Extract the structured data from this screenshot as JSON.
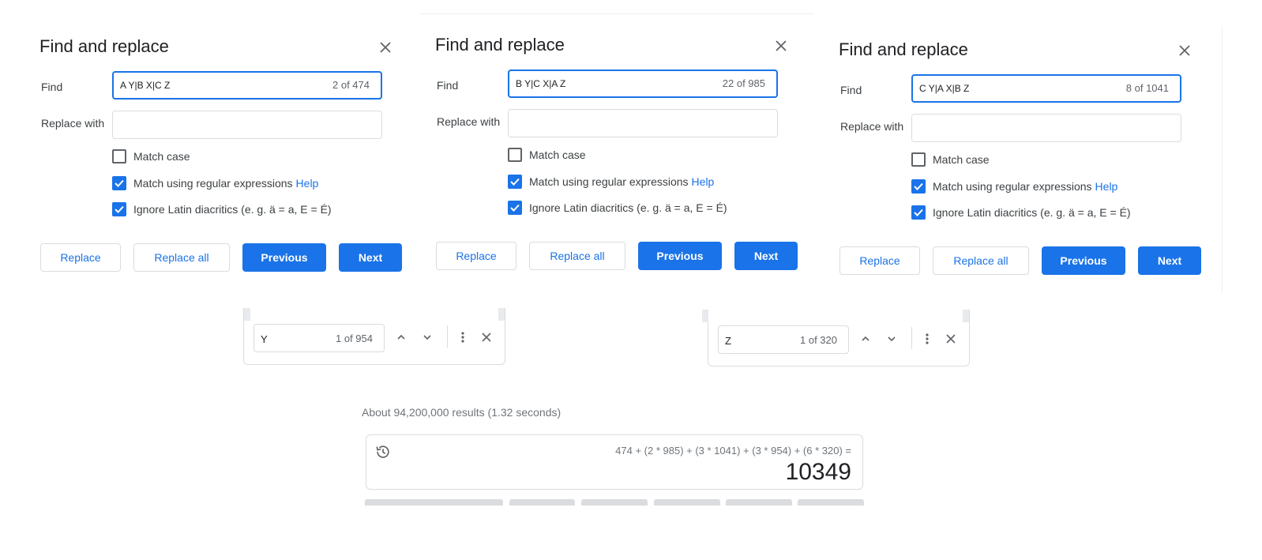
{
  "dialogs": [
    {
      "title": "Find and replace",
      "find_label": "Find",
      "find_value": "A Y|B X|C Z",
      "find_count": "2 of 474",
      "replace_label": "Replace with",
      "replace_value": "",
      "options": [
        {
          "label": "Match case",
          "checked": false
        },
        {
          "label": "Match using regular expressions",
          "checked": true,
          "help": "Help"
        },
        {
          "label": "Ignore Latin diacritics (e. g. ä = a, E = É)",
          "checked": true
        }
      ],
      "buttons": {
        "replace": "Replace",
        "replace_all": "Replace all",
        "previous": "Previous",
        "next": "Next"
      }
    },
    {
      "title": "Find and replace",
      "find_label": "Find",
      "find_value": "B Y|C X|A Z",
      "find_count": "22 of 985",
      "replace_label": "Replace with",
      "replace_value": "",
      "options": [
        {
          "label": "Match case",
          "checked": false
        },
        {
          "label": "Match using regular expressions",
          "checked": true,
          "help": "Help"
        },
        {
          "label": "Ignore Latin diacritics (e. g. ä = a, E = É)",
          "checked": true
        }
      ],
      "buttons": {
        "replace": "Replace",
        "replace_all": "Replace all",
        "previous": "Previous",
        "next": "Next"
      }
    },
    {
      "title": "Find and replace",
      "find_label": "Find",
      "find_value": "C Y|A X|B Z",
      "find_count": "8 of 1041",
      "replace_label": "Replace with",
      "replace_value": "",
      "options": [
        {
          "label": "Match case",
          "checked": false
        },
        {
          "label": "Match using regular expressions",
          "checked": true,
          "help": "Help"
        },
        {
          "label": "Ignore Latin diacritics (e. g. ä = a, E = É)",
          "checked": true
        }
      ],
      "buttons": {
        "replace": "Replace",
        "replace_all": "Replace all",
        "previous": "Previous",
        "next": "Next"
      }
    }
  ],
  "find_bars": [
    {
      "query": "Y",
      "count": "1 of 954",
      "icons": [
        "chevron-up-icon",
        "chevron-down-icon",
        "more-vert-icon",
        "close-icon"
      ]
    },
    {
      "query": "Z",
      "count": "1 of 320",
      "icons": [
        "chevron-up-icon",
        "chevron-down-icon",
        "more-vert-icon",
        "close-icon"
      ]
    }
  ],
  "search": {
    "result_stats": "About 94,200,000 results (1.32 seconds)"
  },
  "calculator": {
    "expression": "474 + (2 * 985) + (3 * 1041) + (3 * 954) + (6 * 320) =",
    "result": "10349",
    "history_icon": "history-icon"
  },
  "colors": {
    "accent": "#1a73e8",
    "border": "#dadce0",
    "text": "#202124",
    "muted": "#5f6368"
  }
}
